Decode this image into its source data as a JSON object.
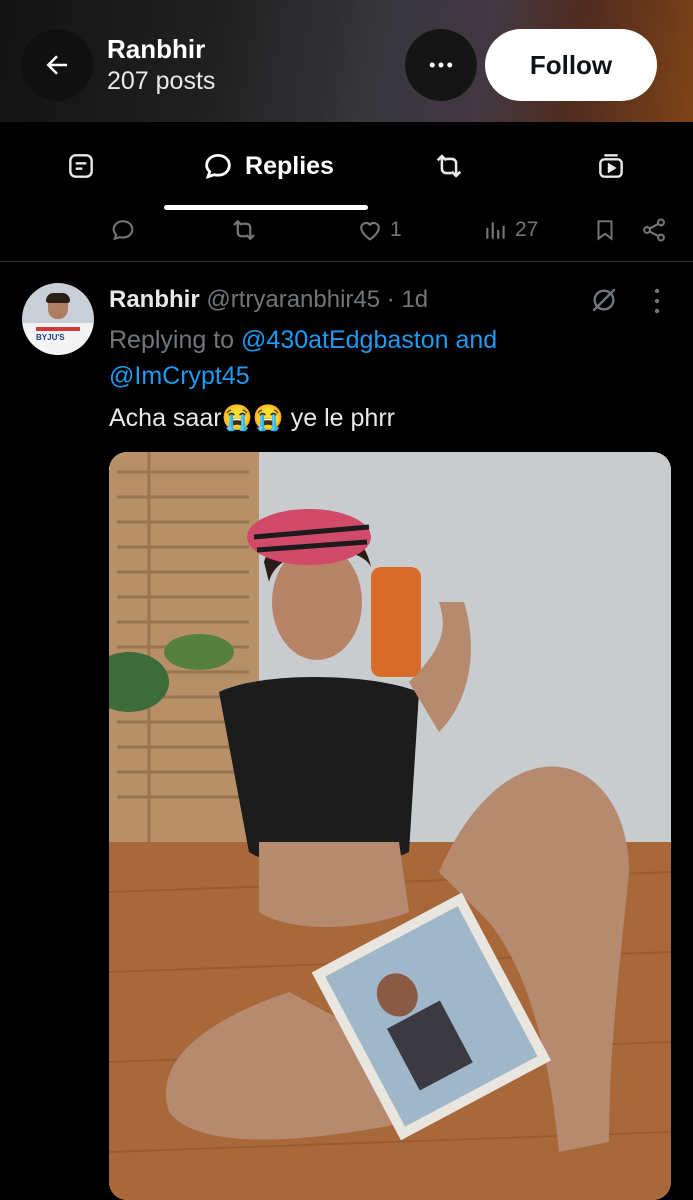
{
  "header": {
    "name": "Ranbhir",
    "posts": "207 posts",
    "follow_label": "Follow"
  },
  "tabs": [
    {
      "icon": "article-icon",
      "label": ""
    },
    {
      "icon": "reply-bubble-icon",
      "label": "Replies",
      "active": true
    },
    {
      "icon": "repost-icon",
      "label": ""
    },
    {
      "icon": "media-icon",
      "label": ""
    }
  ],
  "previous_post_actions": {
    "reply_count": "",
    "repost_count": "",
    "like_count": "1",
    "view_count": "27"
  },
  "post": {
    "author_name": "Ranbhir",
    "handle_time": "@rtryaranbhir45 · 1d",
    "replying_prefix": "Replying to ",
    "reply_to_1": "@430atEdgbaston",
    "reply_and": " and",
    "reply_to_2": "@ImCrypt45",
    "text": "Acha saar😭😭 ye le phrr",
    "avatar_badge": "BYJU'S"
  },
  "colors": {
    "background": "#000000",
    "text_primary": "#e7e9ea",
    "text_secondary": "#71767b",
    "link": "#1d9bf0",
    "follow_bg": "#ffffff"
  }
}
